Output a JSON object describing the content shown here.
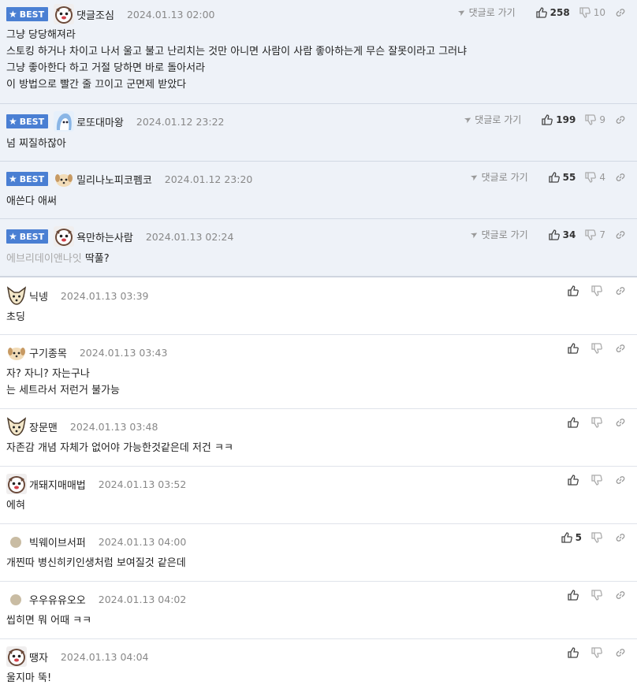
{
  "labels": {
    "best": "BEST",
    "goto": "댓글로 가기"
  },
  "colors": {
    "best_bg": "#eef2f8",
    "badge": "#4a7fd3"
  },
  "best_comments": [
    {
      "avatar": "dog-white-avatar",
      "nick": "댓글조심",
      "date": "2024.01.13 02:00",
      "likes": "258",
      "dislikes": "10",
      "lines": [
        "그냥 당당해져라",
        "스토킹 하거나 차이고 나서 울고 불고 난리치는 것만 아니면 사람이 사람 좋아하는게 무슨 잘못이라고 그러냐",
        "그냥 좋아한다 하고 거절 당하면 바로 돌아서라",
        "이 방법으로 빨간 줄 끄이고 군면제 받았다"
      ]
    },
    {
      "avatar": "blue-creature-avatar",
      "nick": "로또대마왕",
      "date": "2024.01.12 23:22",
      "likes": "199",
      "dislikes": "9",
      "lines": [
        "넘 찌질하잖아"
      ]
    },
    {
      "avatar": "puppy-avatar",
      "nick": "밀리나노피코펨코",
      "date": "2024.01.12 23:20",
      "likes": "55",
      "dislikes": "4",
      "lines": [
        "애쓴다 애써"
      ]
    },
    {
      "avatar": "dog-white-avatar",
      "nick": "욕만하는사람",
      "date": "2024.01.13 02:24",
      "likes": "34",
      "dislikes": "7",
      "ref": "에브리데이앤나잇",
      "lines": [
        "딱풀?"
      ]
    }
  ],
  "comments": [
    {
      "avatar": "fox-avatar",
      "nick": "닉넹",
      "date": "2024.01.13 03:39",
      "likes": "",
      "lines": [
        "초딩"
      ]
    },
    {
      "avatar": "puppy-avatar",
      "nick": "구기종목",
      "date": "2024.01.13 03:43",
      "likes": "",
      "lines": [
        "자? 자니? 자는구나",
        "는 세트라서 저런거 불가능"
      ]
    },
    {
      "avatar": "fox-avatar",
      "nick": "장문맨",
      "date": "2024.01.13 03:48",
      "likes": "",
      "lines": [
        "자존감 개념 자체가 없어야 가능한것같은데 저건 ㅋㅋ"
      ]
    },
    {
      "avatar": "dog-white-avatar",
      "nick": "개돼지매매법",
      "date": "2024.01.13 03:52",
      "likes": "",
      "lines": [
        "에혀"
      ]
    },
    {
      "avatar": "blank-avatar",
      "nick": "빅웨이브서퍼",
      "date": "2024.01.13 04:00",
      "likes": "5",
      "lines": [
        "개찐따 병신히키인생처럼 보여질것 같은데"
      ]
    },
    {
      "avatar": "blank-avatar",
      "nick": "우우유유오오",
      "date": "2024.01.13 04:02",
      "likes": "",
      "lines": [
        "씹히면 뭐 어때 ㅋㅋ"
      ]
    },
    {
      "avatar": "dog-white-avatar",
      "nick": "땡자",
      "date": "2024.01.13 04:04",
      "likes": "",
      "lines": [
        "울지마 뚝!"
      ]
    }
  ]
}
